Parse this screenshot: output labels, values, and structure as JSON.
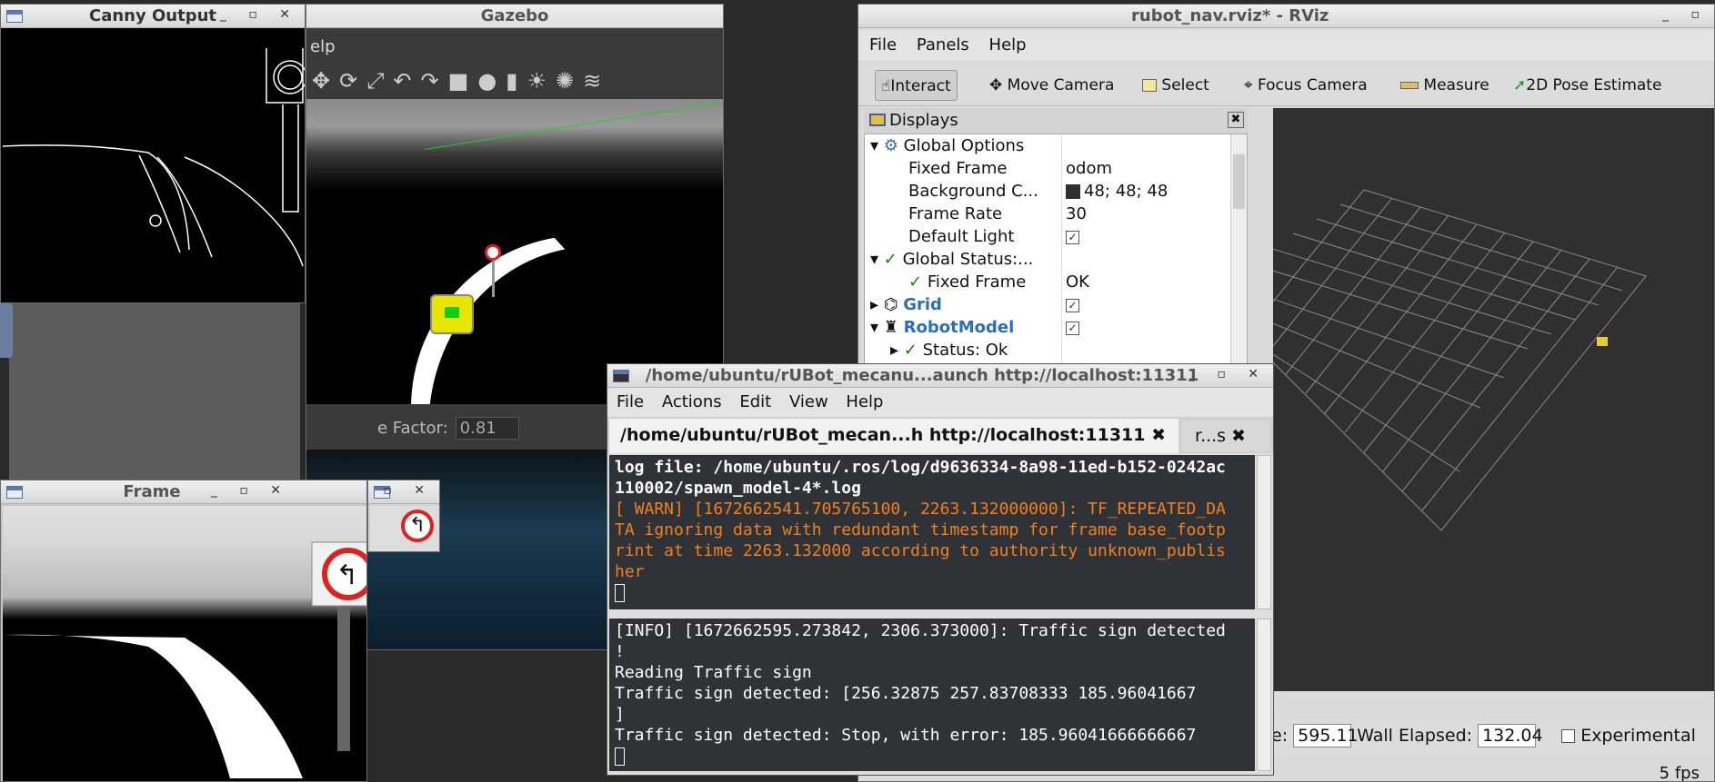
{
  "gazebo": {
    "title": "Gazebo",
    "menu_partial": "elp",
    "toolbar_icons": [
      "translate-icon",
      "rotate-icon",
      "scale-icon",
      "undo-icon",
      "redo-icon",
      "box-icon",
      "sphere-icon",
      "cylinder-icon",
      "sun-icon",
      "spotlight-icon",
      "lines-icon"
    ],
    "factor_label": "e Factor:",
    "factor_value": "0.81"
  },
  "rviz": {
    "title": "rubot_nav.rviz* - RViz",
    "menu": [
      "File",
      "Panels",
      "Help"
    ],
    "tools": [
      "Interact",
      "Move Camera",
      "Select",
      "Focus Camera",
      "Measure",
      "2D Pose Estimate"
    ],
    "displays_title": "Displays",
    "tree": [
      {
        "label": "Global Options",
        "value": ""
      },
      {
        "label": "Fixed Frame",
        "value": "odom"
      },
      {
        "label": "Background C...",
        "value": "48; 48; 48"
      },
      {
        "label": "Frame Rate",
        "value": "30"
      },
      {
        "label": "Default Light",
        "value": ""
      },
      {
        "label": "Global Status:...",
        "value": ""
      },
      {
        "label": "Fixed Frame",
        "value": "OK"
      },
      {
        "label": "Grid",
        "value": ""
      },
      {
        "label": "RobotModel",
        "value": ""
      },
      {
        "label": "Status: Ok",
        "value": ""
      }
    ],
    "background_color": "#303030",
    "status": {
      "ros_elapsed_label": "e:",
      "ros_elapsed": "595.11",
      "wall_elapsed_label": "Wall Elapsed:",
      "wall_elapsed": "132.04",
      "experimental": "Experimental"
    },
    "fps": "5 fps"
  },
  "canny": {
    "title": "Canny Output"
  },
  "frame": {
    "title": "Frame"
  },
  "terminal": {
    "title": "/home/ubuntu/rUBot_mecanu...aunch http://localhost:11311",
    "menu": [
      "File",
      "Actions",
      "Edit",
      "View",
      "Help"
    ],
    "tab1": "/home/ubuntu/rUBot_mecan...h http://localhost:11311",
    "tab2": "r...s",
    "pane1": [
      "log file: /home/ubuntu/.ros/log/d9636334-8a98-11ed-b152-0242ac",
      "110002/spawn_model-4*.log"
    ],
    "pane1_warn": [
      "[ WARN] [1672662541.705765100, 2263.132000000]: TF_REPEATED_DA",
      "TA ignoring data with redundant timestamp for frame base_footp",
      "rint at time 2263.132000 according to authority unknown_publis",
      "her"
    ],
    "pane2": [
      "[INFO] [1672662595.273842, 2306.373000]: Traffic sign detected",
      "!",
      "Reading Traffic sign",
      "Traffic sign detected: [256.32875    257.83708333 185.96041667",
      "]",
      "Traffic sign detected: Stop, with error: 185.96041666666667"
    ]
  }
}
